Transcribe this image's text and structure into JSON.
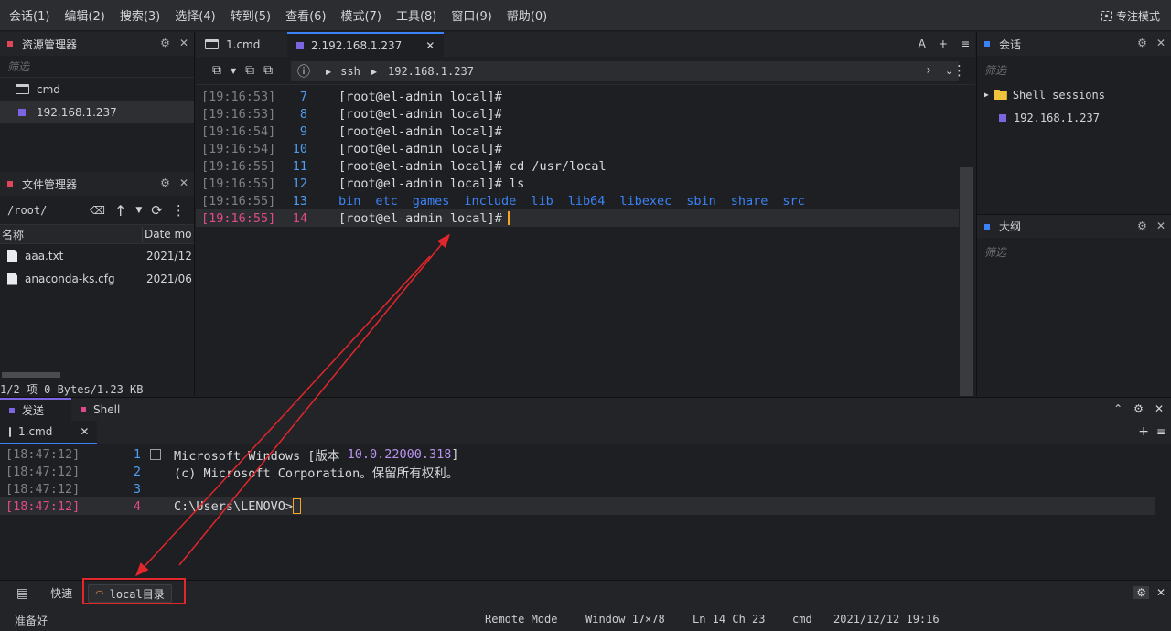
{
  "menu": [
    "会话(1)",
    "编辑(2)",
    "搜索(3)",
    "选择(4)",
    "转到(5)",
    "查看(6)",
    "模式(7)",
    "工具(8)",
    "窗口(9)",
    "帮助(0)"
  ],
  "focus_mode": "专注模式",
  "left": {
    "resource_title": "资源管理器",
    "filter_placeholder": "筛选",
    "items": [
      {
        "label": "cmd"
      },
      {
        "label": "192.168.1.237"
      }
    ],
    "file_title": "文件管理器",
    "path": "/root/",
    "col_name": "名称",
    "col_date": "Date mo",
    "files": [
      {
        "name": "aaa.txt",
        "date": "2021/12"
      },
      {
        "name": "anaconda-ks.cfg",
        "date": "2021/06"
      }
    ],
    "summary": "1/2 项 0 Bytes/1.23 KB"
  },
  "tabs": [
    {
      "label": "1.cmd"
    },
    {
      "label": "2.192.168.1.237"
    }
  ],
  "tab_controls": {
    "font": "A",
    "add": "+",
    "menu": "≡"
  },
  "crumb": {
    "a": "ssh",
    "b": "192.168.1.237"
  },
  "terminal": {
    "lines": [
      {
        "ts": "[19:16:53]",
        "n": "7",
        "text": "[root@el-admin local]#"
      },
      {
        "ts": "[19:16:53]",
        "n": "8",
        "text": "[root@el-admin local]#"
      },
      {
        "ts": "[19:16:54]",
        "n": "9",
        "text": "[root@el-admin local]#"
      },
      {
        "ts": "[19:16:54]",
        "n": "10",
        "text": "[root@el-admin local]#"
      },
      {
        "ts": "[19:16:55]",
        "n": "11",
        "text": "[root@el-admin local]# cd /usr/local"
      },
      {
        "ts": "[19:16:55]",
        "n": "12",
        "text": "[root@el-admin local]# ls"
      }
    ],
    "ls_line": {
      "ts": "[19:16:55]",
      "n": "13",
      "dirs": [
        "bin",
        "etc",
        "games",
        "include",
        "lib",
        "lib64",
        "libexec",
        "sbin",
        "share",
        "src"
      ]
    },
    "current": {
      "ts": "[19:16:55]",
      "n": "14",
      "text": "[root@el-admin local]#"
    }
  },
  "right": {
    "session_title": "会话",
    "filter_placeholder": "筛选",
    "tree_folder": "Shell sessions",
    "tree_item": "192.168.1.237",
    "outline_title": "大纲",
    "outline_filter": "筛选"
  },
  "bottom": {
    "tab_send": "发送",
    "tab_shell": "Shell",
    "subtab": "1.cmd",
    "lines": [
      {
        "ts": "[18:47:12]",
        "n": "1",
        "pre": "Microsoft Windows [版本 ",
        "ver": "10.0.22000.318",
        "post": "]"
      },
      {
        "ts": "[18:47:12]",
        "n": "2",
        "text": "(c) Microsoft Corporation。保留所有权利。"
      },
      {
        "ts": "[18:47:12]",
        "n": "3",
        "text": ""
      },
      {
        "ts": "[18:47:12]",
        "n": "4",
        "text": "C:\\Users\\LENOVO>"
      }
    ]
  },
  "quick": {
    "label": "快速",
    "button": "local目录"
  },
  "status": {
    "ready": "准备好",
    "mode": "Remote Mode",
    "window": "Window 17×78",
    "pos": "Ln 14 Ch 23",
    "shell": "cmd",
    "datetime": "2021/12/12 19:16"
  },
  "colors": {
    "accent": "#3b82f6",
    "timestamp_current": "#e04a8a",
    "annotation": "#e3262b",
    "session": "#7d64e0"
  }
}
